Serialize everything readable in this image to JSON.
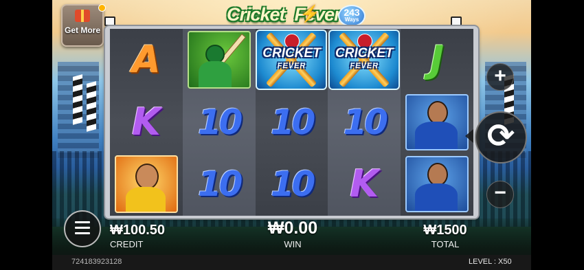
{
  "header": {
    "title_part1": "Cricket",
    "title_part2": "Fever",
    "ways_count": "243",
    "ways_label": "Ways",
    "get_more_label": "Get More"
  },
  "reels": [
    [
      "A",
      "K",
      "player-yellow"
    ],
    [
      "player-batsman-green",
      "10",
      "10"
    ],
    [
      "wild",
      "10",
      "10"
    ],
    [
      "wild",
      "10",
      "K"
    ],
    [
      "J",
      "player-blue",
      "player-blue"
    ]
  ],
  "wild_symbol": {
    "line1": "CRICKET",
    "line2": "FEVER"
  },
  "controls": {
    "plus": "+",
    "minus": "−",
    "spin_icon": "spin-icon",
    "menu_icon": "menu-icon"
  },
  "stats": {
    "credit_value": "₩100.50",
    "credit_label": "CREDIT",
    "win_value": "₩0.00",
    "win_label": "WIN",
    "total_value": "₩1500",
    "total_label": "TOTAL"
  },
  "footer": {
    "game_id": "724183923128",
    "level": "LEVEL : X50"
  },
  "colors": {
    "frame": "#c9ccd2",
    "reel_dark": "#3b3f47",
    "reel_light": "#505560",
    "ten_blue": "#3c6ef0",
    "k_purple": "#b25cf0",
    "a_orange": "#ff9a2e",
    "j_green": "#58cc38"
  }
}
